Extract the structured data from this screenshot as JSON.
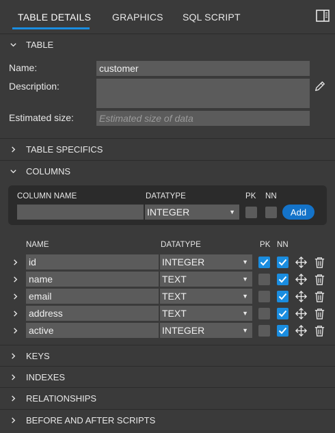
{
  "tabs": [
    {
      "label": "TABLE DETAILS",
      "active": true
    },
    {
      "label": "GRAPHICS",
      "active": false
    },
    {
      "label": "SQL SCRIPT",
      "active": false
    }
  ],
  "sections": {
    "table": "TABLE",
    "table_specifics": "TABLE SPECIFICS",
    "columns": "COLUMNS",
    "keys": "KEYS",
    "indexes": "INDEXES",
    "relationships": "RELATIONSHIPS",
    "before_after": "BEFORE AND AFTER SCRIPTS"
  },
  "table_form": {
    "name_label": "Name:",
    "name_value": "customer",
    "description_label": "Description:",
    "description_value": "",
    "size_label": "Estimated size:",
    "size_placeholder": "Estimated size of data"
  },
  "new_column": {
    "name_header": "COLUMN NAME",
    "datatype_header": "DATATYPE",
    "pk_header": "PK",
    "nn_header": "NN",
    "name_value": "",
    "datatype_value": "INTEGER",
    "pk": false,
    "nn": false,
    "add_label": "Add"
  },
  "columns_list": {
    "name_header": "NAME",
    "datatype_header": "DATATYPE",
    "pk_header": "PK",
    "nn_header": "NN",
    "rows": [
      {
        "name": "id",
        "datatype": "INTEGER",
        "pk": true,
        "nn": true
      },
      {
        "name": "name",
        "datatype": "TEXT",
        "pk": false,
        "nn": true
      },
      {
        "name": "email",
        "datatype": "TEXT",
        "pk": false,
        "nn": true
      },
      {
        "name": "address",
        "datatype": "TEXT",
        "pk": false,
        "nn": true
      },
      {
        "name": "active",
        "datatype": "INTEGER",
        "pk": false,
        "nn": true
      }
    ]
  },
  "icons": {
    "panel_toggle": "panel-toggle-icon",
    "edit": "pencil-icon",
    "move": "move-arrows-icon",
    "delete": "trash-icon"
  },
  "colors": {
    "background": "#3a3a3a",
    "field": "#5b5b5b",
    "accent": "#1a8de0",
    "add_button": "#1473c9"
  }
}
